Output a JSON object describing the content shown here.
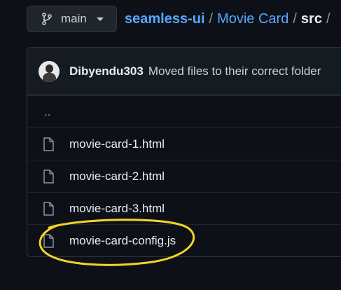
{
  "branch": {
    "name": "main",
    "icon": "git-branch-icon"
  },
  "breadcrumb": {
    "repo": "seamless-ui",
    "folder": "Movie Card",
    "current": "src",
    "separator": "/"
  },
  "commit": {
    "author": "Dibyendu303",
    "message": "Moved files to their correct folder"
  },
  "parent_dir": "..",
  "files": [
    {
      "name": "movie-card-1.html",
      "icon": "file-icon"
    },
    {
      "name": "movie-card-2.html",
      "icon": "file-icon"
    },
    {
      "name": "movie-card-3.html",
      "icon": "file-icon"
    },
    {
      "name": "movie-card-config.js",
      "icon": "file-icon"
    }
  ],
  "colors": {
    "link": "#58a6ff",
    "annotation": "#f5d328",
    "background": "#0d1117"
  }
}
